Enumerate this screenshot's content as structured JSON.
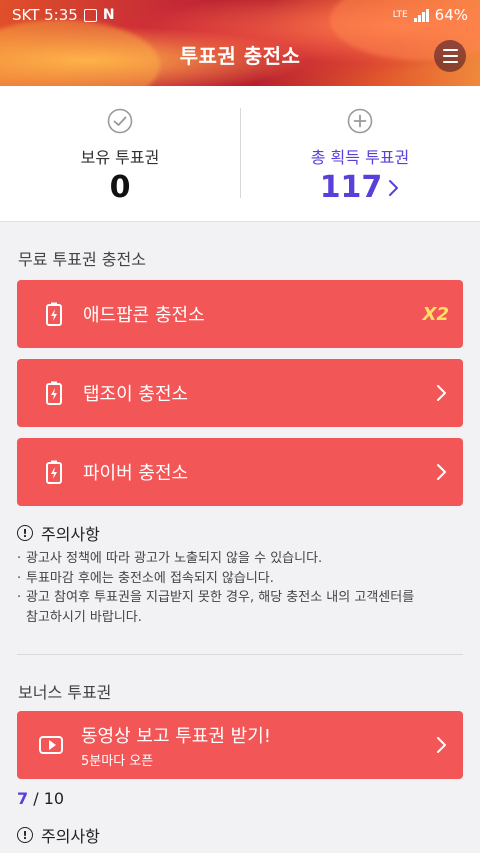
{
  "statusbar": {
    "carrier_time": "SKT 5:35",
    "lte": "LTE",
    "battery": "64%"
  },
  "header": {
    "title": "투표권 충전소",
    "menu_icon": "hamburger-menu-icon"
  },
  "summary": {
    "owned_label": "보유 투표권",
    "owned_value": "0",
    "total_label": "총 획득 투표권",
    "total_value": "117",
    "accent_color": "#5b3fd9"
  },
  "free_section": {
    "title": "무료 투표권 충전소",
    "items": [
      {
        "label": "애드팝콘 충전소",
        "badge": "X2"
      },
      {
        "label": "탭조이 충전소"
      },
      {
        "label": "파이버 충전소"
      }
    ],
    "button_color": "#f25656"
  },
  "notice": {
    "title": "주의사항",
    "lines": [
      "광고사 정책에 따라 광고가 노출되지 않을 수 있습니다.",
      "투표마감 후에는 충전소에 접속되지 않습니다.",
      "광고 참여후 투표권을 지급받지 못한 경우, 해당 충전소 내의 고객센터를",
      "참고하시기 바랍니다."
    ]
  },
  "bonus_section": {
    "title": "보너스 투표권",
    "video_button": {
      "label": "동영상 보고 투표권 받기!",
      "sublabel": "5분마다 오픈"
    },
    "progress_current": "7",
    "progress_sep": " / ",
    "progress_total": "10",
    "notice_title": "주의사항"
  }
}
